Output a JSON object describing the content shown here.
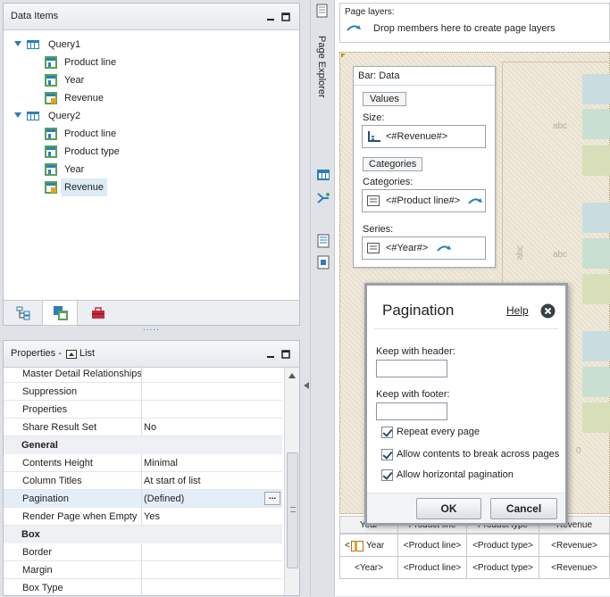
{
  "data_items": {
    "title": "Data Items",
    "tree": [
      {
        "label": "Query1",
        "kind": "query"
      },
      {
        "label": "Product line",
        "kind": "level"
      },
      {
        "label": "Year",
        "kind": "level"
      },
      {
        "label": "Revenue",
        "kind": "measure"
      },
      {
        "label": "Query2",
        "kind": "query"
      },
      {
        "label": "Product line",
        "kind": "level"
      },
      {
        "label": "Product type",
        "kind": "level"
      },
      {
        "label": "Year",
        "kind": "level"
      },
      {
        "label": "Revenue",
        "kind": "measure",
        "selected": true
      }
    ],
    "tab_icons": [
      "source-tree-icon",
      "data-items-icon",
      "toolbox-icon"
    ],
    "splitter_dots": "....."
  },
  "properties": {
    "title": "Properties -",
    "context": "List",
    "rows": [
      {
        "name": "Master Detail Relationships",
        "value": ""
      },
      {
        "name": "Suppression",
        "value": ""
      },
      {
        "name": "Properties",
        "value": ""
      },
      {
        "name": "Share Result Set",
        "value": "No"
      },
      {
        "name": "General",
        "value": "",
        "group": true
      },
      {
        "name": "Contents Height",
        "value": "Minimal"
      },
      {
        "name": "Column Titles",
        "value": "At start of list"
      },
      {
        "name": "Pagination",
        "value": "(Defined)",
        "selected": true,
        "ellipsis": "..."
      },
      {
        "name": "Render Page when Empty",
        "value": "Yes"
      },
      {
        "name": "Box",
        "value": "",
        "group": true
      },
      {
        "name": "Border",
        "value": ""
      },
      {
        "name": "Margin",
        "value": ""
      },
      {
        "name": "Box Type",
        "value": ""
      }
    ]
  },
  "explorer": {
    "label": "Page Explorer"
  },
  "page_layers": {
    "label": "Page layers:",
    "hint": "Drop members here to create page layers"
  },
  "chart_panel": {
    "title": "Bar: Data",
    "values_btn": "Values",
    "size_label": "Size:",
    "size_value": "<#Revenue#>",
    "categories_btn": "Categories",
    "categories_label": "Categories:",
    "categories_value": "<#Product line#>",
    "series_label": "Series:",
    "series_value": "<#Year#>",
    "placeholder_abc": "abc",
    "axis_zero": "0",
    "swatch_colors": [
      "#c9dde0",
      "#c9dfd2",
      "#d8dfb8",
      "#c9dde0",
      "#c9dfd2",
      "#d8dfb8",
      "#c9dde0",
      "#c9dfd2",
      "#d8dfb8"
    ]
  },
  "list_table": {
    "headers": [
      "Year",
      "Product line",
      "Product type",
      "Revenue"
    ],
    "rows": [
      [
        "Year",
        "<Product line>",
        "<Product type>",
        "<Revenue>"
      ],
      [
        "<Year>",
        "<Product line>",
        "<Product type>",
        "<Revenue>"
      ]
    ],
    "row1_prefix": "<"
  },
  "dialog": {
    "title": "Pagination",
    "help": "Help",
    "keep_header_label": "Keep with header:",
    "keep_header_value": "",
    "keep_footer_label": "Keep with footer:",
    "keep_footer_value": "",
    "checks": [
      {
        "label": "Repeat every page",
        "checked": true
      },
      {
        "label": "Allow contents to break across pages",
        "checked": true
      },
      {
        "label": "Allow horizontal pagination",
        "checked": true
      }
    ],
    "ok": "OK",
    "cancel": "Cancel"
  }
}
